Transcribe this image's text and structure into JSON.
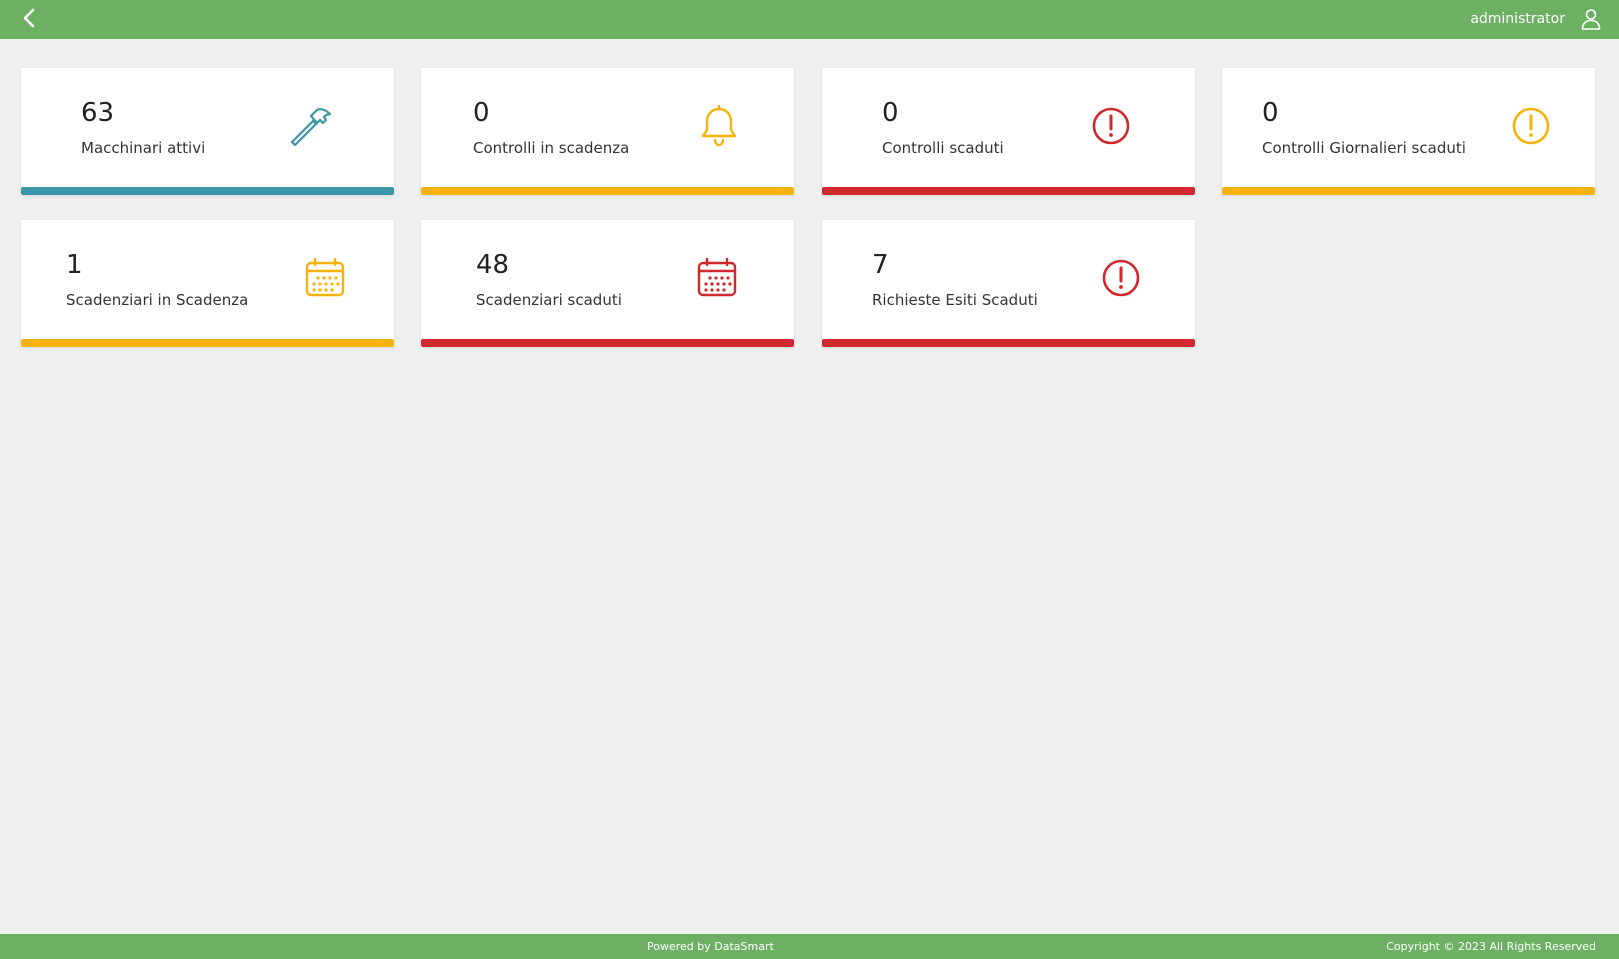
{
  "header": {
    "user_name": "administrator",
    "colors": {
      "bar": "#6db064"
    }
  },
  "cards": [
    {
      "value": "63",
      "label": "Macchinari attivi",
      "icon": "hammer-icon",
      "accent": "#3a97a8"
    },
    {
      "value": "0",
      "label": "Controlli in scadenza",
      "icon": "bell-icon",
      "accent": "#f7b20c"
    },
    {
      "value": "0",
      "label": "Controlli scaduti",
      "icon": "alert-circle-icon",
      "accent": "#d0282d"
    },
    {
      "value": "0",
      "label": "Controlli Giornalieri scaduti",
      "icon": "alert-circle-icon",
      "accent": "#f7b20c"
    },
    {
      "value": "1",
      "label": "Scadenziari in Scadenza",
      "icon": "calendar-icon",
      "accent": "#f7b20c"
    },
    {
      "value": "48",
      "label": "Scadenziari scaduti",
      "icon": "calendar-icon",
      "accent": "#d0282d"
    },
    {
      "value": "7",
      "label": "Richieste Esiti Scaduti",
      "icon": "alert-circle-icon",
      "accent": "#d0282d"
    }
  ],
  "footer": {
    "powered_by": "Powered by DataSmart",
    "copyright": "Copyright © 2023 All Rights Reserved"
  }
}
